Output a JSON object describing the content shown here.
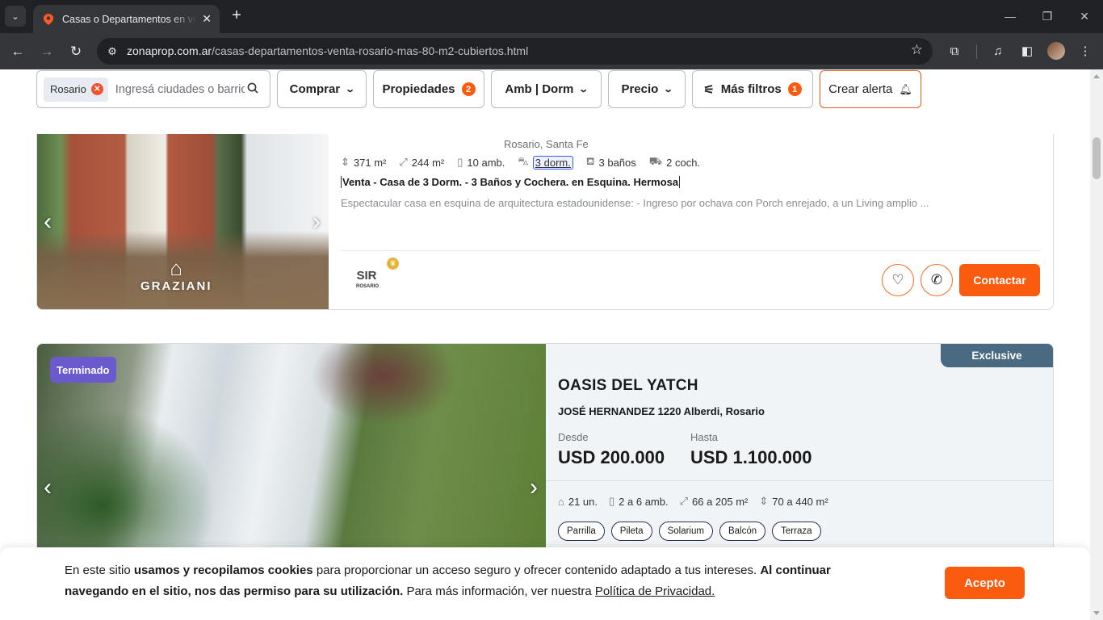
{
  "browser": {
    "tab_title": "Casas o Departamentos en venta",
    "url_domain": "zonaprop.com.ar",
    "url_path": "/casas-departamentos-venta-rosario-mas-80-m2-cubiertos.html"
  },
  "filters": {
    "location_chip": "Rosario",
    "search_placeholder": "Ingresá ciudades o barrios",
    "operation": "Comprar",
    "property_type": "Propiedades",
    "property_type_count": "2",
    "rooms": "Amb | Dorm",
    "price": "Precio",
    "more_filters": "Más filtros",
    "more_filters_count": "1",
    "create_alert": "Crear alerta"
  },
  "listing1": {
    "location": "Rosario, Santa Fe",
    "total_area": "371 m²",
    "covered_area": "244 m²",
    "rooms": "10 amb.",
    "bedrooms": "3 dorm.",
    "bathrooms": "3 baños",
    "parking": "2 coch.",
    "title": "Venta - Casa de 3 Dorm. - 3 Baños y Cochera. en Esquina. Hermosa",
    "description": "Espectacular casa en esquina de arquitectura estadounidense: - Ingreso por ochava con Porch enrejado, a un Living amplio ...",
    "photo_brand": "GRAZIANI",
    "agency_logo_top": "SIR",
    "agency_logo_bottom": "ROSARIO",
    "contact_label": "Contactar"
  },
  "listing2": {
    "status_tag": "Terminado",
    "exclusive_label": "Exclusive",
    "title": "OASIS DEL YATCH",
    "address": "JOSÉ HERNANDEZ 1220 Alberdi, Rosario",
    "price_from_label": "Desde",
    "price_from": "USD 200.000",
    "price_to_label": "Hasta",
    "price_to": "USD 1.100.000",
    "units": "21 un.",
    "rooms": "2 a 6 amb.",
    "covered_area": "66 a 205 m²",
    "total_area": "70 a 440 m²",
    "amenities": [
      "Parrilla",
      "Pileta",
      "Solarium",
      "Balcón",
      "Terraza"
    ]
  },
  "cookie": {
    "text_1": "En este sitio ",
    "text_bold_1": "usamos y recopilamos cookies",
    "text_2": " para proporcionar un acceso seguro y ofrecer contenido adaptado a tus intereses. ",
    "text_bold_2": "Al continuar navegando en el sitio, nos das permiso para su utilización.",
    "text_3": " Para más información, ver nuestra ",
    "link": "Política de Privacidad.",
    "accept_label": "Acepto"
  },
  "colors": {
    "brand_orange": "#f95b0f",
    "exclusive_blue": "#4a6a82",
    "terminado_purple": "#6a5acd"
  }
}
